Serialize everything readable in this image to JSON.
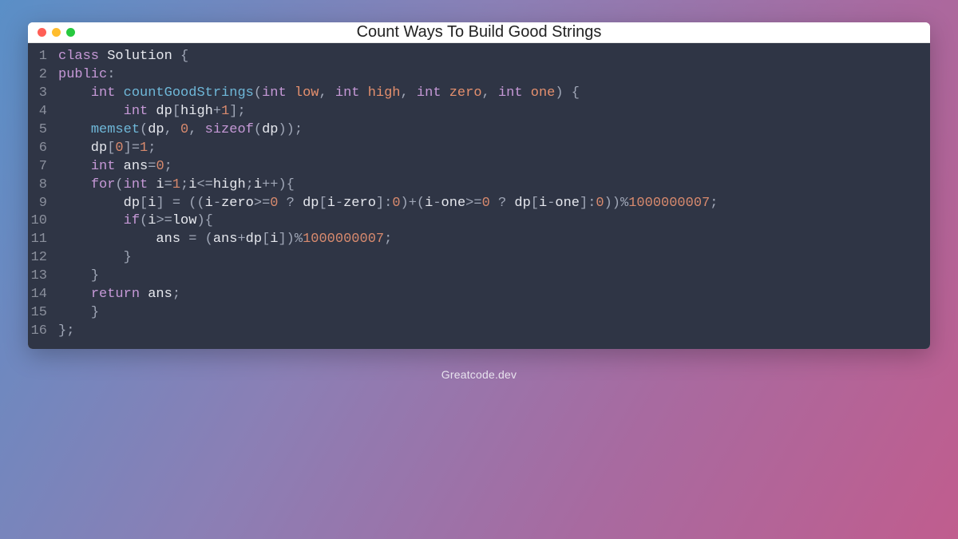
{
  "window": {
    "title": "Count Ways To Build Good Strings"
  },
  "footer": {
    "text": "Greatcode.dev"
  },
  "code": {
    "language": "cpp",
    "lines": [
      {
        "n": "1",
        "tokens": [
          [
            "kw",
            "class"
          ],
          [
            "id",
            " Solution "
          ],
          [
            "op",
            "{"
          ]
        ]
      },
      {
        "n": "2",
        "tokens": [
          [
            "kw",
            "public"
          ],
          [
            "op",
            ":"
          ]
        ]
      },
      {
        "n": "3",
        "tokens": [
          [
            "id",
            "    "
          ],
          [
            "kw",
            "int"
          ],
          [
            "id",
            " "
          ],
          [
            "fn",
            "countGoodStrings"
          ],
          [
            "op",
            "("
          ],
          [
            "kw",
            "int"
          ],
          [
            "id",
            " "
          ],
          [
            "prm",
            "low"
          ],
          [
            "op",
            ", "
          ],
          [
            "kw",
            "int"
          ],
          [
            "id",
            " "
          ],
          [
            "prm",
            "high"
          ],
          [
            "op",
            ", "
          ],
          [
            "kw",
            "int"
          ],
          [
            "id",
            " "
          ],
          [
            "prm",
            "zero"
          ],
          [
            "op",
            ", "
          ],
          [
            "kw",
            "int"
          ],
          [
            "id",
            " "
          ],
          [
            "prm",
            "one"
          ],
          [
            "op",
            ") {"
          ]
        ]
      },
      {
        "n": "4",
        "tokens": [
          [
            "id",
            "        "
          ],
          [
            "kw",
            "int"
          ],
          [
            "id",
            " dp"
          ],
          [
            "op",
            "["
          ],
          [
            "id",
            "high"
          ],
          [
            "op",
            "+"
          ],
          [
            "num",
            "1"
          ],
          [
            "op",
            "];"
          ]
        ]
      },
      {
        "n": "5",
        "tokens": [
          [
            "id",
            "    "
          ],
          [
            "fn",
            "memset"
          ],
          [
            "op",
            "("
          ],
          [
            "id",
            "dp"
          ],
          [
            "op",
            ", "
          ],
          [
            "num",
            "0"
          ],
          [
            "op",
            ", "
          ],
          [
            "kw",
            "sizeof"
          ],
          [
            "op",
            "("
          ],
          [
            "id",
            "dp"
          ],
          [
            "op",
            "));"
          ]
        ]
      },
      {
        "n": "6",
        "tokens": [
          [
            "id",
            "    dp"
          ],
          [
            "op",
            "["
          ],
          [
            "num",
            "0"
          ],
          [
            "op",
            "]="
          ],
          [
            "num",
            "1"
          ],
          [
            "op",
            ";"
          ]
        ]
      },
      {
        "n": "7",
        "tokens": [
          [
            "id",
            "    "
          ],
          [
            "kw",
            "int"
          ],
          [
            "id",
            " ans"
          ],
          [
            "op",
            "="
          ],
          [
            "num",
            "0"
          ],
          [
            "op",
            ";"
          ]
        ]
      },
      {
        "n": "8",
        "tokens": [
          [
            "id",
            "    "
          ],
          [
            "kw",
            "for"
          ],
          [
            "op",
            "("
          ],
          [
            "kw",
            "int"
          ],
          [
            "id",
            " i"
          ],
          [
            "op",
            "="
          ],
          [
            "num",
            "1"
          ],
          [
            "op",
            ";"
          ],
          [
            "id",
            "i"
          ],
          [
            "op",
            "<="
          ],
          [
            "id",
            "high"
          ],
          [
            "op",
            ";"
          ],
          [
            "id",
            "i"
          ],
          [
            "op",
            "++){"
          ]
        ]
      },
      {
        "n": "9",
        "tokens": [
          [
            "id",
            "        dp"
          ],
          [
            "op",
            "["
          ],
          [
            "id",
            "i"
          ],
          [
            "op",
            "] = (("
          ],
          [
            "id",
            "i"
          ],
          [
            "op",
            "-"
          ],
          [
            "id",
            "zero"
          ],
          [
            "op",
            ">="
          ],
          [
            "num",
            "0"
          ],
          [
            "op",
            " ? "
          ],
          [
            "id",
            "dp"
          ],
          [
            "op",
            "["
          ],
          [
            "id",
            "i"
          ],
          [
            "op",
            "-"
          ],
          [
            "id",
            "zero"
          ],
          [
            "op",
            "]:"
          ],
          [
            "num",
            "0"
          ],
          [
            "op",
            ")+("
          ],
          [
            "id",
            "i"
          ],
          [
            "op",
            "-"
          ],
          [
            "id",
            "one"
          ],
          [
            "op",
            ">="
          ],
          [
            "num",
            "0"
          ],
          [
            "op",
            " ? "
          ],
          [
            "id",
            "dp"
          ],
          [
            "op",
            "["
          ],
          [
            "id",
            "i"
          ],
          [
            "op",
            "-"
          ],
          [
            "id",
            "one"
          ],
          [
            "op",
            "]:"
          ],
          [
            "num",
            "0"
          ],
          [
            "op",
            "))%"
          ],
          [
            "num",
            "1000000007"
          ],
          [
            "op",
            ";"
          ]
        ]
      },
      {
        "n": "10",
        "tokens": [
          [
            "id",
            "        "
          ],
          [
            "kw",
            "if"
          ],
          [
            "op",
            "("
          ],
          [
            "id",
            "i"
          ],
          [
            "op",
            ">="
          ],
          [
            "id",
            "low"
          ],
          [
            "op",
            "){"
          ]
        ]
      },
      {
        "n": "11",
        "tokens": [
          [
            "id",
            "            ans "
          ],
          [
            "op",
            "= ("
          ],
          [
            "id",
            "ans"
          ],
          [
            "op",
            "+"
          ],
          [
            "id",
            "dp"
          ],
          [
            "op",
            "["
          ],
          [
            "id",
            "i"
          ],
          [
            "op",
            "])%"
          ],
          [
            "num",
            "1000000007"
          ],
          [
            "op",
            ";"
          ]
        ]
      },
      {
        "n": "12",
        "tokens": [
          [
            "id",
            "        "
          ],
          [
            "op",
            "}"
          ]
        ]
      },
      {
        "n": "13",
        "tokens": [
          [
            "id",
            "    "
          ],
          [
            "op",
            "}"
          ]
        ]
      },
      {
        "n": "14",
        "tokens": [
          [
            "id",
            "    "
          ],
          [
            "kw",
            "return"
          ],
          [
            "id",
            " ans"
          ],
          [
            "op",
            ";"
          ]
        ]
      },
      {
        "n": "15",
        "tokens": [
          [
            "id",
            "    "
          ],
          [
            "op",
            "}"
          ]
        ]
      },
      {
        "n": "16",
        "tokens": [
          [
            "op",
            "};"
          ]
        ]
      }
    ]
  }
}
